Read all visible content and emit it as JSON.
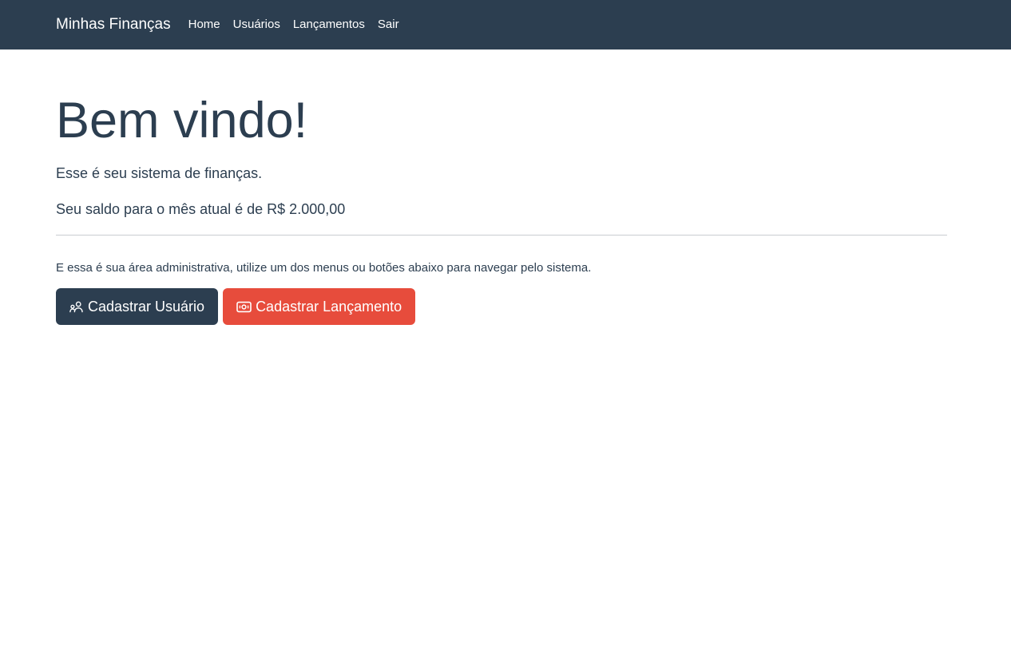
{
  "navbar": {
    "brand": "Minhas Finanças",
    "items": [
      {
        "id": "home",
        "label": "Home"
      },
      {
        "id": "usuarios",
        "label": "Usuários"
      },
      {
        "id": "lancamentos",
        "label": "Lançamentos"
      },
      {
        "id": "sair",
        "label": "Sair"
      }
    ]
  },
  "main": {
    "title": "Bem vindo!",
    "subtitle": "Esse é seu sistema de finanças.",
    "balance_text": "Seu saldo para o mês atual é de R$ 2.000,00",
    "balance_value": "R$ 2.000,00",
    "admin_hint": "E essa é sua área administrativa, utilize um dos menus ou botões abaixo para navegar pelo sistema.",
    "buttons": [
      {
        "label": "Cadastrar Usuário",
        "icon": "users-icon",
        "color": "#2c3e50"
      },
      {
        "label": "Cadastrar Lançamento",
        "icon": "banknote-icon",
        "color": "#e74c3c"
      }
    ]
  },
  "colors": {
    "navbar_bg": "#2c3e50",
    "nav_text": "#ffffff",
    "text": "#2c3e50",
    "primary_button": "#2c3e50",
    "danger_button": "#e74c3c",
    "divider": "#c9cdd1",
    "background": "#ffffff"
  }
}
